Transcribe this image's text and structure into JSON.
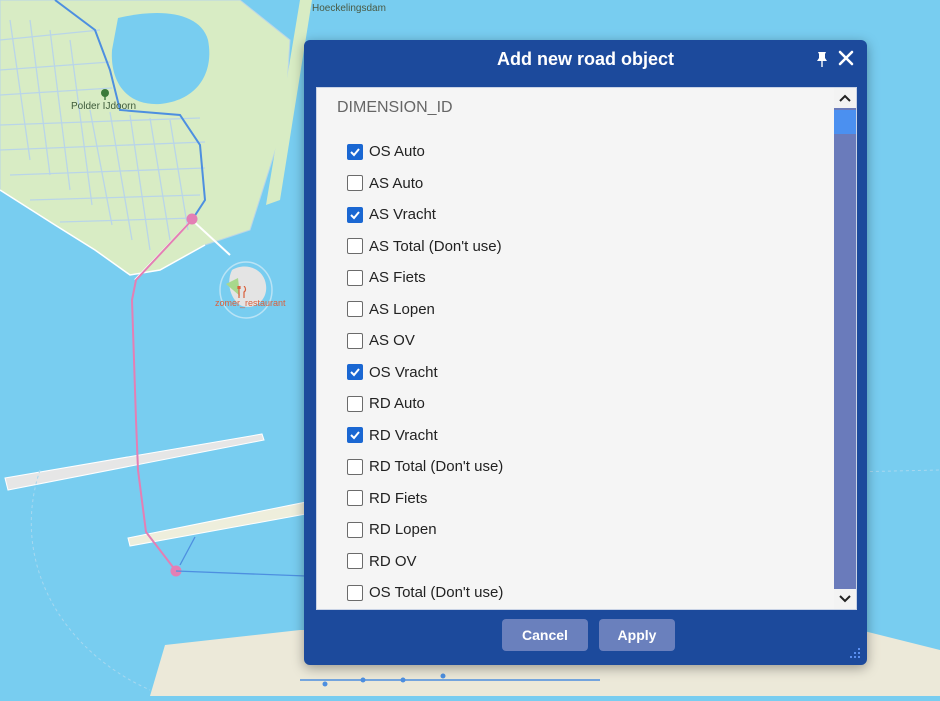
{
  "map": {
    "labels": {
      "dam": "Hoeckelingsdam",
      "polder": "Polder IJdoorn",
      "restaurant": "zomer_restaurant"
    }
  },
  "dialog": {
    "title": "Add new road object",
    "list_header": "DIMENSION_ID",
    "options": [
      {
        "label": "OS Auto",
        "checked": true
      },
      {
        "label": "AS Auto",
        "checked": false
      },
      {
        "label": "AS Vracht",
        "checked": true
      },
      {
        "label": "AS Total (Don't use)",
        "checked": false
      },
      {
        "label": "AS Fiets",
        "checked": false
      },
      {
        "label": "AS Lopen",
        "checked": false
      },
      {
        "label": "AS OV",
        "checked": false
      },
      {
        "label": "OS Vracht",
        "checked": true
      },
      {
        "label": "RD Auto",
        "checked": false
      },
      {
        "label": "RD Vracht",
        "checked": true
      },
      {
        "label": "RD Total (Don't use)",
        "checked": false
      },
      {
        "label": "RD Fiets",
        "checked": false
      },
      {
        "label": "RD Lopen",
        "checked": false
      },
      {
        "label": "RD OV",
        "checked": false
      },
      {
        "label": "OS Total (Don't use)",
        "checked": false
      }
    ],
    "cancel_label": "Cancel",
    "apply_label": "Apply"
  },
  "icons": {
    "pin": "pin-icon",
    "close": "close-icon",
    "scroll_up": "chevron-up-icon",
    "scroll_down": "chevron-down-icon",
    "resize": "resize-grip-icon",
    "tree": "tree-icon",
    "restaurant": "fork-knife-icon"
  },
  "colors": {
    "water": "#78cdf0",
    "land": "#dcedc8",
    "dialog": "#1c4a9c",
    "checkbox_on": "#1a67d2",
    "route": "#e47fb4",
    "button": "#6a80bd"
  }
}
